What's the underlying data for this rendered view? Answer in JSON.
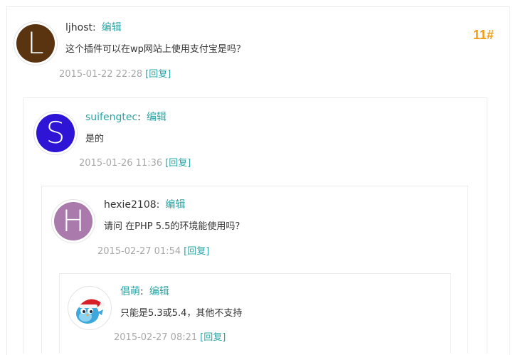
{
  "colors": {
    "accent": "#2ba4a4",
    "floor_number": "#f39c12",
    "date": "#a8a8a8",
    "border": "#ececec"
  },
  "comments": [
    {
      "floor": "11#",
      "avatar_letter": "L",
      "avatar_color": "#5a3410",
      "author": "ljhost",
      "edit": "编辑",
      "content": "这个插件可以在wp网站上使用支付宝是吗？",
      "date": "2015-01-22 22:28",
      "reply": "[回复]"
    },
    {
      "avatar_letter": "S",
      "avatar_color": "#2e15d6",
      "author": "suifengtec",
      "edit": "编辑",
      "content": "是的",
      "date": "2015-01-26 11:36",
      "reply": "[回复]"
    },
    {
      "avatar_letter": "H",
      "avatar_color": "#a97aab",
      "author": "hexie2108",
      "edit": "编辑",
      "content": "请问 在PHP 5.5的环境能使用吗？",
      "date": "2015-02-27 01:54",
      "reply": "[回复]"
    },
    {
      "avatar_icon": "blue-bird-santa-hat-icon",
      "author": "倡萌",
      "edit": "编辑",
      "content": "只能是5.3或5.4，其他不支持",
      "date": "2015-02-27 08:21",
      "reply": "[回复]"
    }
  ]
}
